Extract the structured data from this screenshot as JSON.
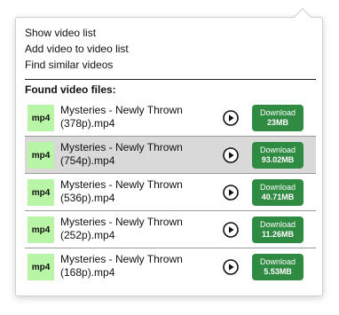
{
  "menu": {
    "items": [
      "Show video list",
      "Add video to video list",
      "Find similar videos"
    ]
  },
  "found_label": "Found video files:",
  "videos": [
    {
      "format": "mp4",
      "title": "Mysteries - Newly Thrown (378p).mp4",
      "button_label": "Download",
      "size": "23MB",
      "selected": false
    },
    {
      "format": "mp4",
      "title": "Mysteries - Newly Thrown (754p).mp4",
      "button_label": "Download",
      "size": "93.02MB",
      "selected": true
    },
    {
      "format": "mp4",
      "title": "Mysteries - Newly Thrown (536p).mp4",
      "button_label": "Download",
      "size": "40.71MB",
      "selected": false
    },
    {
      "format": "mp4",
      "title": "Mysteries - Newly Thrown (252p).mp4",
      "button_label": "Download",
      "size": "11.26MB",
      "selected": false
    },
    {
      "format": "mp4",
      "title": "Mysteries - Newly Thrown (168p).mp4",
      "button_label": "Download",
      "size": "5.53MB",
      "selected": false
    }
  ],
  "colors": {
    "download_button": "#2f8a42",
    "format_badge": "#b9f5a6",
    "selected_row": "#d9d9d9"
  },
  "icons": {
    "play": "play-circle-icon"
  }
}
